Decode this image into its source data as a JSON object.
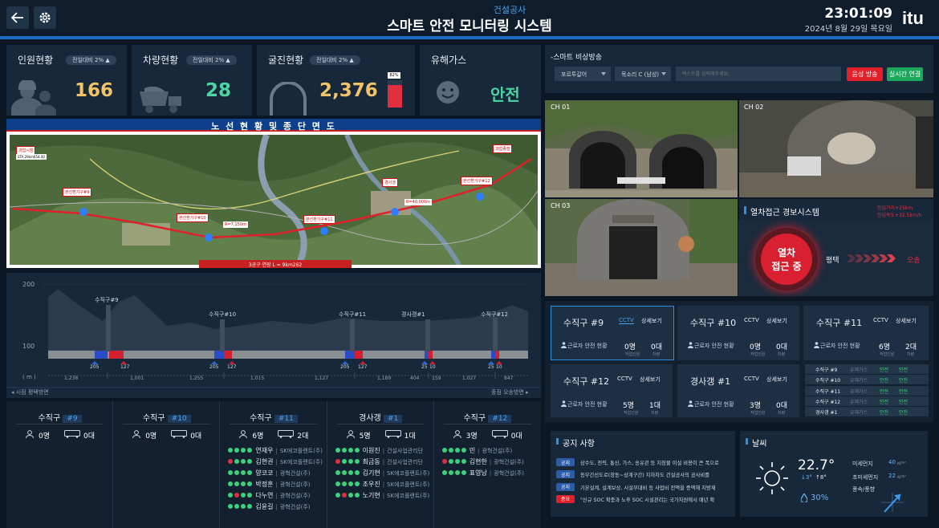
{
  "header": {
    "subtitle": "건설공사",
    "title": "스마트 안전 모니터링 시스템",
    "time": "23:01:09",
    "date": "2024년 8월 29일 목요일",
    "logo": "itu"
  },
  "stats": [
    {
      "label": "인원현황",
      "badge": "전일대비 2% ▲",
      "value": "166",
      "icon": "worker-icon"
    },
    {
      "label": "차량현황",
      "badge": "전일대비 2% ▲",
      "value": "28",
      "icon": "truck-icon"
    },
    {
      "label": "굴진현황",
      "badge": "전일대비 2% ▲",
      "value": "2,376",
      "icon": "tunnel-icon",
      "progress_label": "82%",
      "progress": 82
    },
    {
      "label": "유해가스",
      "value": "안전",
      "icon": "smile-icon"
    }
  ],
  "map": {
    "title": "노 선 현 황 및 종 단 면 도",
    "bottom_label": "3공구 연장 L = 9km262",
    "labels": [
      "과업시점",
      "STA.29km654.00",
      "본선환기구#9",
      "기계환기",
      "본선환기구#10",
      "본선환기구#11",
      "R=7,150m",
      "경사갱",
      "본선환기구#12",
      "R=40,000m",
      "과업종점"
    ]
  },
  "profile": {
    "yticks": [
      "200",
      "100",
      "( m )"
    ],
    "shafts": [
      "수직구#9",
      "수직구#10",
      "수직구#11",
      "경사갱#1",
      "수직구#12"
    ],
    "bar_labels": [
      "205",
      "127",
      "205",
      "127",
      "205",
      "127",
      "25",
      "10",
      "25",
      "10"
    ],
    "distances": [
      "1,238",
      "1,001",
      "1,255",
      "1,015",
      "1,127",
      "1,189",
      "404",
      "159",
      "1,027",
      "847"
    ],
    "left_dir": "◂ 시점 평택방면",
    "right_dir": "종점 오송방면 ▸"
  },
  "sites": [
    {
      "name": "수직구",
      "id": "#9",
      "workers": "0명",
      "vehicles": "0대",
      "people": []
    },
    {
      "name": "수직구",
      "id": "#10",
      "workers": "0명",
      "vehicles": "0대",
      "people": []
    },
    {
      "name": "수직구",
      "id": "#11",
      "workers": "6명",
      "vehicles": "2대",
      "people": [
        {
          "name": "연재우",
          "co": "SK에코플랜트(주)"
        },
        {
          "name": "김현권",
          "co": "SK에코플랜트(주)"
        },
        {
          "name": "양코코",
          "co": "광혁건설(주)"
        },
        {
          "name": "박정훈",
          "co": "광혁건설(주)"
        },
        {
          "name": "다누연",
          "co": "광혁건설(주)"
        },
        {
          "name": "김윤길",
          "co": "광혁건설(주)"
        }
      ]
    },
    {
      "name": "경사갱",
      "id": "#1",
      "workers": "5명",
      "vehicles": "1대",
      "people": [
        {
          "name": "이원진",
          "co": "건설사업관리단"
        },
        {
          "name": "최금동",
          "co": "건설사업관리단"
        },
        {
          "name": "김기현",
          "co": "SK에코플랜트(주)"
        },
        {
          "name": "조우진",
          "co": "SK에코플랜트(주)"
        },
        {
          "name": "노기현",
          "co": "SK에코플랜트(주)"
        }
      ]
    },
    {
      "name": "수직구",
      "id": "#12",
      "workers": "3명",
      "vehicles": "0대",
      "people": [
        {
          "name": "민",
          "co": "광혁건설(주)"
        },
        {
          "name": "김현한",
          "co": "광혁건설(주)"
        },
        {
          "name": "표영남",
          "co": "광혁건설(주)"
        }
      ]
    }
  ],
  "broadcast": {
    "title": "-스마트 비상방송",
    "lang": "포르투갈어",
    "voice": "목소리 C (남성)",
    "placeholder": "텍스트를 입력해주세요.",
    "btn_voice": "음성 방송",
    "btn_live": "실시간 연결"
  },
  "cctv": {
    "channels": [
      "CH 01",
      "CH 02",
      "CH 03"
    ]
  },
  "alarm": {
    "title": "열차접근 경보시스템",
    "dist": "진입거리+25km",
    "speed": "진입속도+32.5km/h",
    "status_line1": "열차",
    "status_line2": "접근 중",
    "from": "평택",
    "to": "오송"
  },
  "site_cards": [
    {
      "name": "수직구 #9",
      "cctv": "CCTV",
      "detail": "상세보기",
      "wlabel": "근로자 안전 현황",
      "workers": "0명",
      "vehicles": "0대",
      "sub1": "작업인원",
      "sub2": "차량"
    },
    {
      "name": "수직구 #10",
      "cctv": "CCTV",
      "detail": "상세보기",
      "wlabel": "근로자 안전 현황",
      "workers": "0명",
      "vehicles": "0대",
      "sub1": "작업인원",
      "sub2": "차량"
    },
    {
      "name": "수직구 #11",
      "cctv": "CCTV",
      "detail": "상세보기",
      "wlabel": "근로자 안전 현황",
      "workers": "6명",
      "vehicles": "2대",
      "sub1": "작업인원",
      "sub2": "차량"
    },
    {
      "name": "수직구 #12",
      "cctv": "CCTV",
      "detail": "상세보기",
      "wlabel": "근로자 안전 현황",
      "workers": "5명",
      "vehicles": "1대",
      "sub1": "작업인원",
      "sub2": "차량"
    },
    {
      "name": "경사갱 #1",
      "cctv": "CCTV",
      "detail": "상세보기",
      "wlabel": "근로자 안전 현황",
      "workers": "3명",
      "vehicles": "0대",
      "sub1": "작업인원",
      "sub2": "차량"
    }
  ],
  "gas": [
    {
      "site": "수직구 #9",
      "label": "유해가스",
      "v1": "안전",
      "v2": "안전"
    },
    {
      "site": "수직구 #10",
      "label": "유해가스",
      "v1": "안전",
      "v2": "안전"
    },
    {
      "site": "수직구 #11",
      "label": "유해가스",
      "v1": "안전",
      "v2": "안전"
    },
    {
      "site": "수직구 #12",
      "label": "유해가스",
      "v1": "안전",
      "v2": "안전"
    },
    {
      "site": "경사갱 #1",
      "label": "유해가스",
      "v1": "안전",
      "v2": "안전"
    }
  ],
  "notice": {
    "title": "공지 사항",
    "items": [
      {
        "tag": "공지",
        "text": "상수도, 전력, 통신, 가스, 송유관 등 지장물 이설 비용이 큰 폭으로"
      },
      {
        "tag": "공지",
        "text": "동부간선도로(창동~상계구간) 지하차도 건설공사의 공사비를"
      },
      {
        "tag": "공지",
        "text": "기본설계, 설계보상, 시설부대비 등 사업비 전액을 증액해 지방재"
      },
      {
        "tag": "중요",
        "text": "\"신규 SOC 확충과 노후 SOC 시설관리는 국가차원에서 매년 확"
      }
    ]
  },
  "weather": {
    "title": "날씨",
    "temp": "22.7°",
    "low": "↓3°",
    "high": "↑8°",
    "humidity": "30%",
    "dust_label": "미세먼지",
    "dust_val": "40",
    "dust_unit": "㎍/m³",
    "fine_label": "초미세먼지",
    "fine_val": "22",
    "fine_unit": "㎍/m³",
    "wind_label": "풍속/풍향"
  }
}
